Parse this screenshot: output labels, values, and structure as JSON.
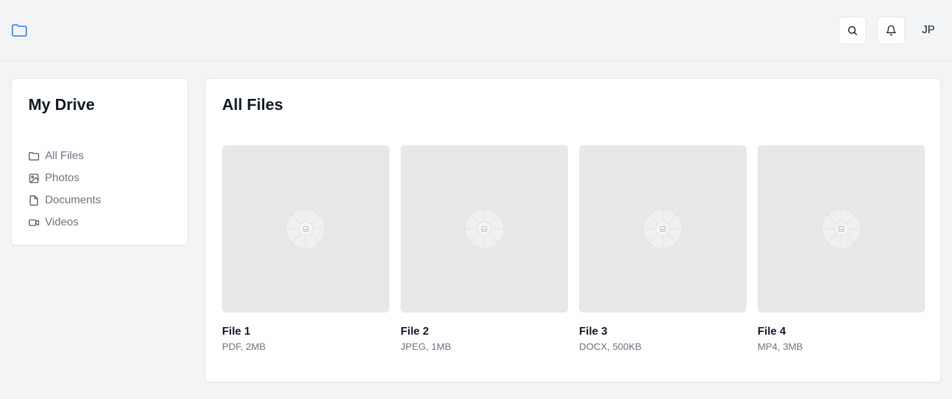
{
  "header": {
    "logo_icon": "folder-icon",
    "search_icon": "search-icon",
    "notifications_icon": "bell-icon",
    "avatar_initials": "JP",
    "accent_color": "#3b82f6"
  },
  "sidebar": {
    "title": "My Drive",
    "items": [
      {
        "label": "All Files",
        "icon": "folder-icon"
      },
      {
        "label": "Photos",
        "icon": "image-icon"
      },
      {
        "label": "Documents",
        "icon": "file-icon"
      },
      {
        "label": "Videos",
        "icon": "video-icon"
      }
    ]
  },
  "main": {
    "title": "All Files",
    "files": [
      {
        "name": "File 1",
        "meta": "PDF, 2MB"
      },
      {
        "name": "File 2",
        "meta": "JPEG, 1MB"
      },
      {
        "name": "File 3",
        "meta": "DOCX, 500KB"
      },
      {
        "name": "File 4",
        "meta": "MP4, 3MB"
      }
    ]
  }
}
